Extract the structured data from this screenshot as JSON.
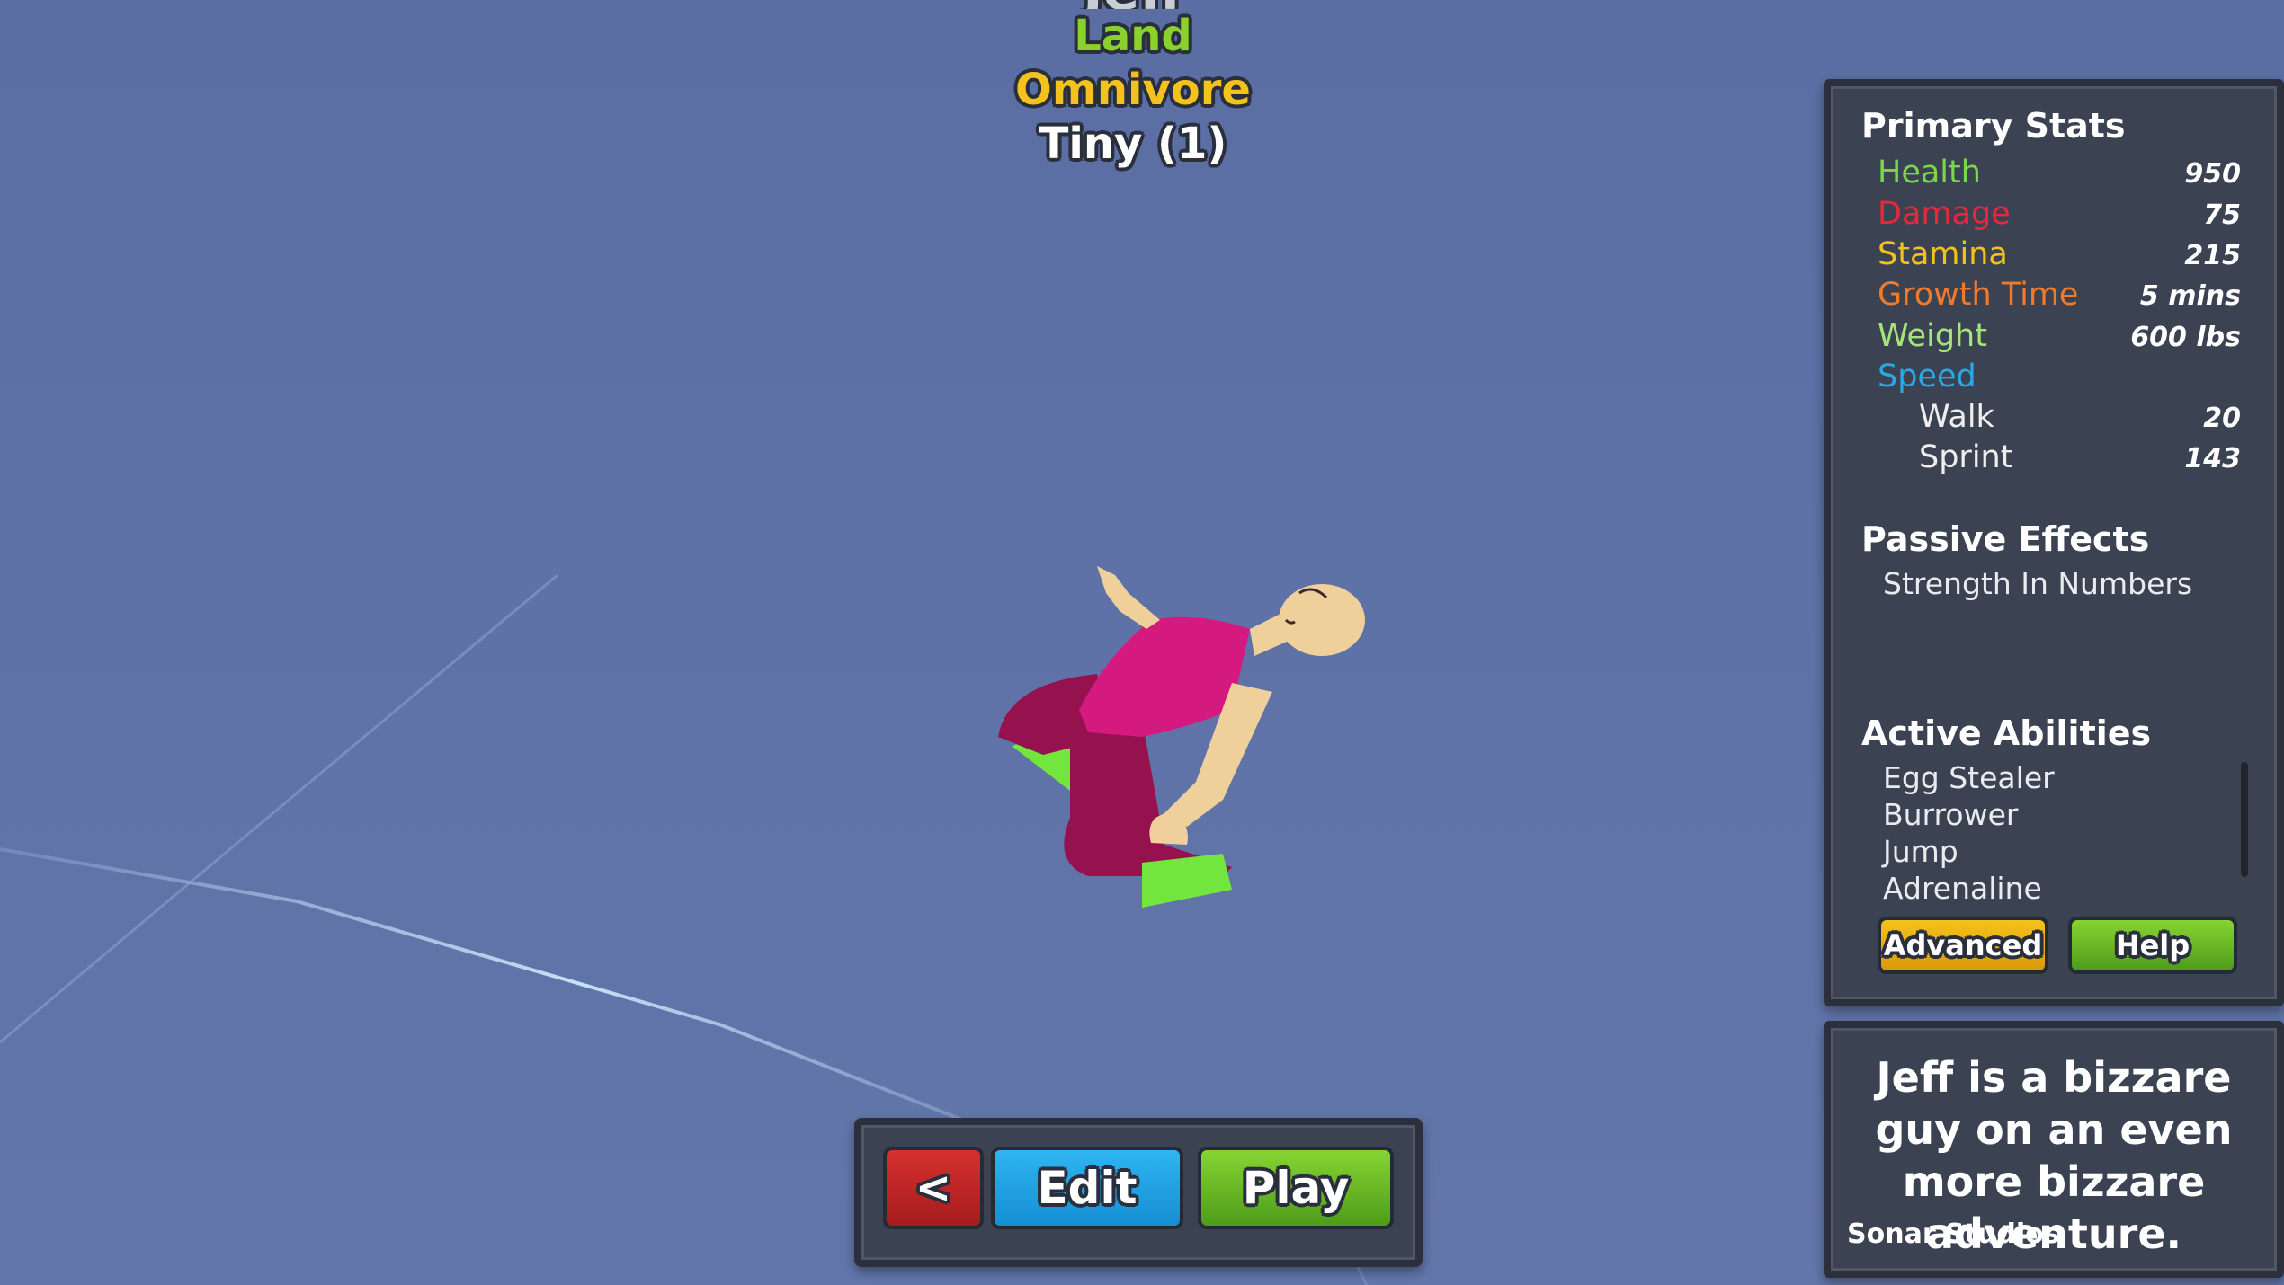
{
  "header": {
    "name": "Jeff",
    "habitat": "Land",
    "diet": "Omnivore",
    "size": "Tiny (1)"
  },
  "primary_stats": {
    "heading": "Primary Stats",
    "health": {
      "label": "Health",
      "value": "950",
      "color": "#7bd64a"
    },
    "damage": {
      "label": "Damage",
      "value": "75",
      "color": "#e8283a"
    },
    "stamina": {
      "label": "Stamina",
      "value": "215",
      "color": "#f2c21c"
    },
    "growth": {
      "label": "Growth Time",
      "value": "5 mins",
      "color": "#f07a2a"
    },
    "weight": {
      "label": "Weight",
      "value": "600 lbs",
      "color": "#a6e37a"
    },
    "speed": {
      "label": "Speed",
      "color": "#29a8e6"
    },
    "walk": {
      "label": "Walk",
      "value": "20"
    },
    "sprint": {
      "label": "Sprint",
      "value": "143"
    }
  },
  "passive": {
    "heading": "Passive Effects",
    "items": [
      "Strength In Numbers"
    ]
  },
  "active": {
    "heading": "Active Abilities",
    "items": [
      "Egg Stealer",
      "Burrower",
      "Jump",
      "Adrenaline"
    ]
  },
  "buttons": {
    "advanced": "Advanced",
    "help": "Help",
    "back": "<",
    "edit": "Edit",
    "play": "Play"
  },
  "description": {
    "text": "Jeff is a bizzare guy on an even more bizzare adventure.",
    "author": "Sonar Studios"
  },
  "colors": {
    "sky": "#5e72a7",
    "skin": "#f0d09a",
    "shirt": "#d41a7e",
    "pants": "#96124e",
    "shoes": "#72e63c"
  }
}
